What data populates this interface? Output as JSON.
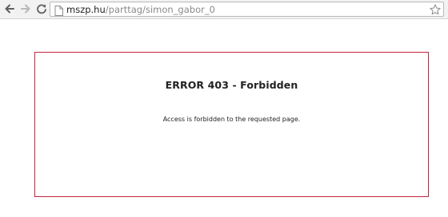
{
  "browser": {
    "url_host": "mszp.hu",
    "url_path": "/parttag/simon_gabor_0",
    "icons": {
      "back": "back-arrow-icon",
      "forward": "forward-arrow-icon",
      "reload": "reload-icon",
      "page": "page-icon",
      "bookmark": "star-icon"
    }
  },
  "page": {
    "error_title": "ERROR 403 - Forbidden",
    "error_message": "Access is forbidden to the requested page.",
    "border_color": "#c3243a"
  }
}
